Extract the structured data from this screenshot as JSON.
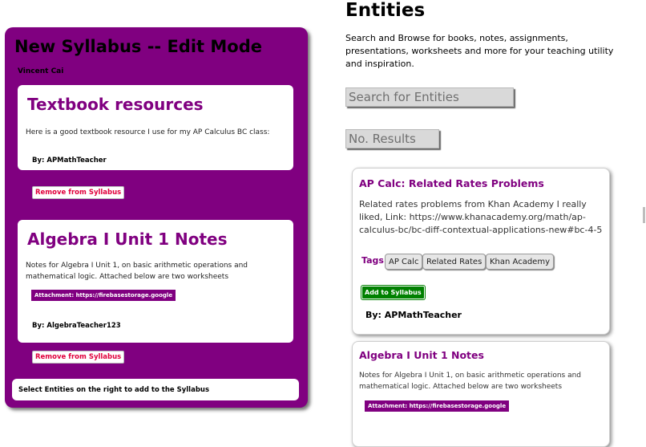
{
  "syllabus": {
    "title": "New Syllabus -- Edit Mode",
    "author": "Vincent Cai",
    "items": [
      {
        "title": "Textbook resources",
        "description": "Here is a good textbook resource I use for my AP Calculus BC class:",
        "by": "By: APMathTeacher",
        "remove_label": "Remove from Syllabus"
      },
      {
        "title": "Algebra I Unit 1 Notes",
        "description": "Notes for Algebra I Unit 1, on basic arithmetic operations and mathematical logic. Attached below are two worksheets",
        "attachment": "Attachment: https://firebasestorage.google",
        "by": "By: AlgebraTeacher123",
        "remove_label": "Remove from Syllabus"
      }
    ],
    "hint": "Select Entities on the right to add to the Syllabus"
  },
  "entities": {
    "title": "Entities",
    "description": "Search and Browse for books, notes, assignments, presentations, worksheets and more for your teaching utility and inspiration.",
    "search_placeholder": "Search for Entities",
    "results_placeholder": "No. Results",
    "cards": [
      {
        "title": "AP Calc: Related Rates Problems",
        "description": "Related rates problems from Khan Academy I really liked, Link: https://www.khanacademy.org/math/ap-calculus-bc/bc-diff-contextual-applications-new#bc-4-5",
        "tags_label": "Tags:",
        "tags": [
          "AP Calc",
          "Related Rates",
          "Khan Academy"
        ],
        "add_label": "Add to Syllabus",
        "by": "By: APMathTeacher"
      },
      {
        "title": "Algebra I Unit 1 Notes",
        "description": "Notes for Algebra I Unit 1, on basic arithmetic operations and mathematical logic. Attached below are two worksheets",
        "attachment": "Attachment: https://firebasestorage.google"
      }
    ]
  },
  "colors": {
    "panel": "#800080",
    "accent_text": "#800080",
    "remove_text": "#e0003c",
    "add_button": "#008000"
  }
}
